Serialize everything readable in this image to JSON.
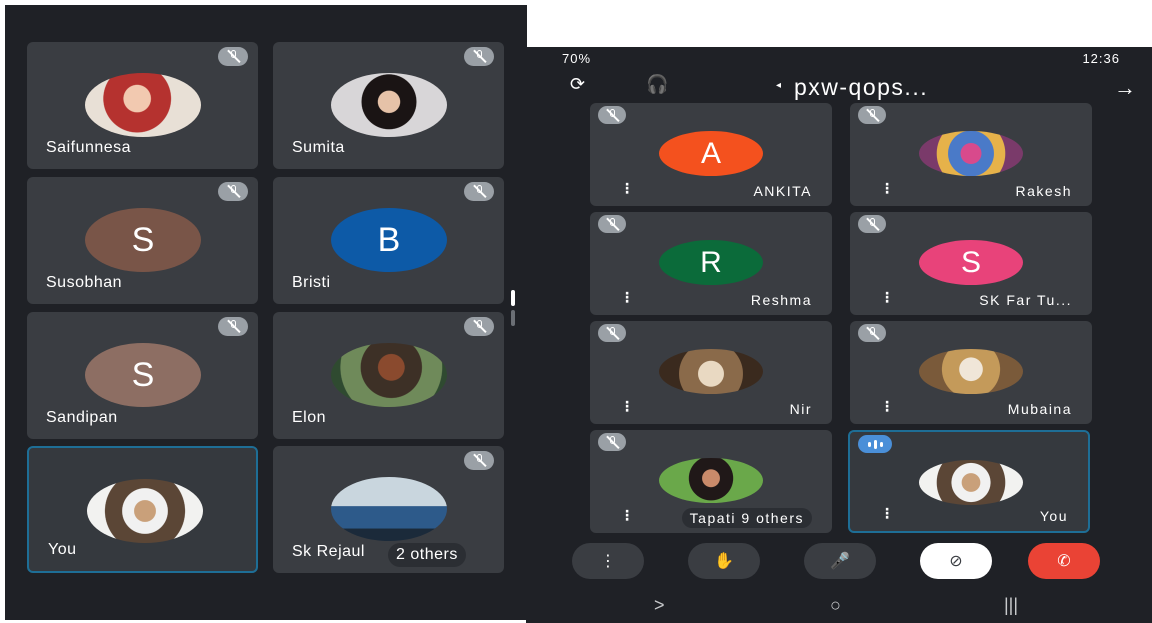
{
  "left_meeting": {
    "participants": [
      {
        "name": "Saifunnesa",
        "avatar_letter": "",
        "avatar_color": "",
        "muted": true
      },
      {
        "name": "Sumita",
        "avatar_letter": "",
        "avatar_color": "",
        "muted": true
      },
      {
        "name": "Susobhan",
        "avatar_letter": "S",
        "avatar_color": "#795548",
        "muted": true
      },
      {
        "name": "Bristi",
        "avatar_letter": "B",
        "avatar_color": "#0d5aa7",
        "muted": true
      },
      {
        "name": "Sandipan",
        "avatar_letter": "S",
        "avatar_color": "#8d6e63",
        "muted": true
      },
      {
        "name": "Elon",
        "avatar_letter": "",
        "avatar_color": "",
        "muted": true
      },
      {
        "name": "You",
        "avatar_letter": "",
        "avatar_color": "",
        "muted": false
      },
      {
        "name": "Sk Rejaul",
        "others": "2 others",
        "avatar_letter": "",
        "avatar_color": "",
        "muted": true
      }
    ]
  },
  "right_meeting": {
    "status_time": "12:36",
    "status_battery": "70%",
    "title": "pxw-qops...",
    "participants": [
      {
        "name": "ANKITA",
        "avatar_letter": "A",
        "avatar_color": "#f4511e"
      },
      {
        "name": "Rakesh",
        "avatar_letter": "",
        "avatar_color": ""
      },
      {
        "name": "Reshma",
        "avatar_letter": "R",
        "avatar_color": "#0b6b3a"
      },
      {
        "name": "SK Far Tu...",
        "avatar_letter": "S",
        "avatar_color": "#e8437a"
      },
      {
        "name": "Nir",
        "avatar_letter": "",
        "avatar_color": ""
      },
      {
        "name": "Mubaina",
        "avatar_letter": "",
        "avatar_color": ""
      },
      {
        "name": "Tapati",
        "others": "9 others",
        "avatar_letter": "",
        "avatar_color": ""
      },
      {
        "name": "You",
        "avatar_letter": "",
        "avatar_color": ""
      }
    ],
    "controls": {
      "more_icon": "more-vert-icon",
      "hand_icon": "raise-hand-icon",
      "mic_icon": "mic-icon",
      "camera_icon": "camera-off-icon",
      "end_icon": "end-call-icon"
    },
    "navbar": {
      "back": ">",
      "home": "○",
      "recents": "|||"
    }
  }
}
